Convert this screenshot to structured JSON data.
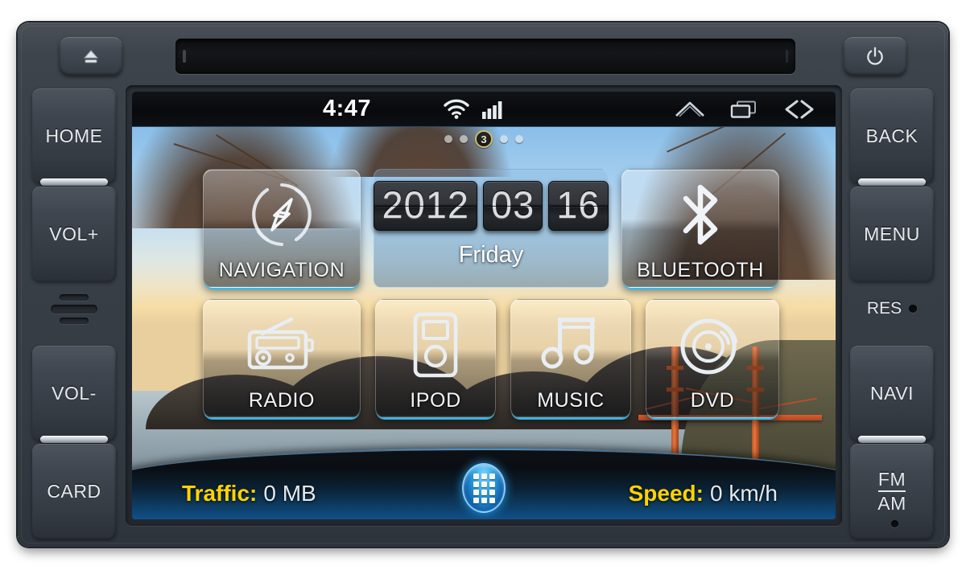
{
  "device": {
    "name": "car-head-unit",
    "top_bar": {
      "eject_icon": "eject-icon",
      "power_icon": "power-icon",
      "cd_slot_label": "disc-slot"
    },
    "left_buttons": [
      {
        "label": "HOME",
        "name": "home"
      },
      {
        "label": "VOL+",
        "name": "volume-up"
      },
      {
        "label": "VOL-",
        "name": "volume-down"
      },
      {
        "label": "CARD",
        "name": "card"
      }
    ],
    "right_buttons": [
      {
        "label": "BACK",
        "name": "back"
      },
      {
        "label": "MENU",
        "name": "menu"
      },
      {
        "label": "NAVI",
        "name": "navi"
      },
      {
        "label": "FM",
        "label2": "AM",
        "name": "fm-am"
      }
    ],
    "reset_label": "RES"
  },
  "screen": {
    "status_bar": {
      "clock": "4:47",
      "wifi_icon": "wifi-icon",
      "signal_icon": "signal-bars-icon",
      "home_icon": "home-outline-icon",
      "recents_icon": "recent-apps-icon",
      "back_icon": "back-arrow-icon"
    },
    "page_indicator": {
      "total_pages": 5,
      "current_page": "3"
    },
    "date_widget": {
      "year": "2012",
      "month": "03",
      "day": "16",
      "weekday": "Friday"
    },
    "tiles": [
      {
        "label": "NAVIGATION",
        "name": "navigation",
        "icon": "compass-icon"
      },
      {
        "label": "BLUETOOTH",
        "name": "bluetooth",
        "icon": "bluetooth-icon"
      },
      {
        "label": "RADIO",
        "name": "radio",
        "icon": "radio-icon"
      },
      {
        "label": "IPOD",
        "name": "ipod",
        "icon": "ipod-icon"
      },
      {
        "label": "MUSIC",
        "name": "music",
        "icon": "music-note-icon"
      },
      {
        "label": "DVD",
        "name": "dvd",
        "icon": "disc-icon"
      }
    ],
    "dock": {
      "traffic_label": "Traffic:",
      "traffic_value": "0 MB",
      "speed_label": "Speed:",
      "speed_value": "0 km/h",
      "app_drawer_icon": "app-grid-icon"
    }
  },
  "colors": {
    "accent_cyan": "#28bdff",
    "dock_key_yellow": "#ffd400",
    "bezel": "#393f47",
    "screen_black": "#0a0c0e"
  }
}
